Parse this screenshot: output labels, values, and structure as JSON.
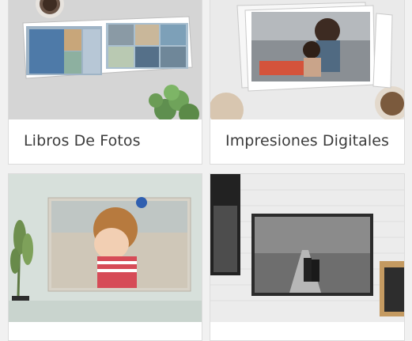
{
  "cards": [
    {
      "label": "Libros De Fotos",
      "image_alt": "photo-book"
    },
    {
      "label": "Impresiones Digitales",
      "image_alt": "digital-prints"
    },
    {
      "label": "",
      "image_alt": "canvas-print"
    },
    {
      "label": "",
      "image_alt": "metal-print"
    }
  ],
  "colors": {
    "page_bg": "#f1f1f1",
    "card_bg": "#ffffff",
    "card_border": "#dcdcdc",
    "label_text": "#3c3c3c"
  }
}
